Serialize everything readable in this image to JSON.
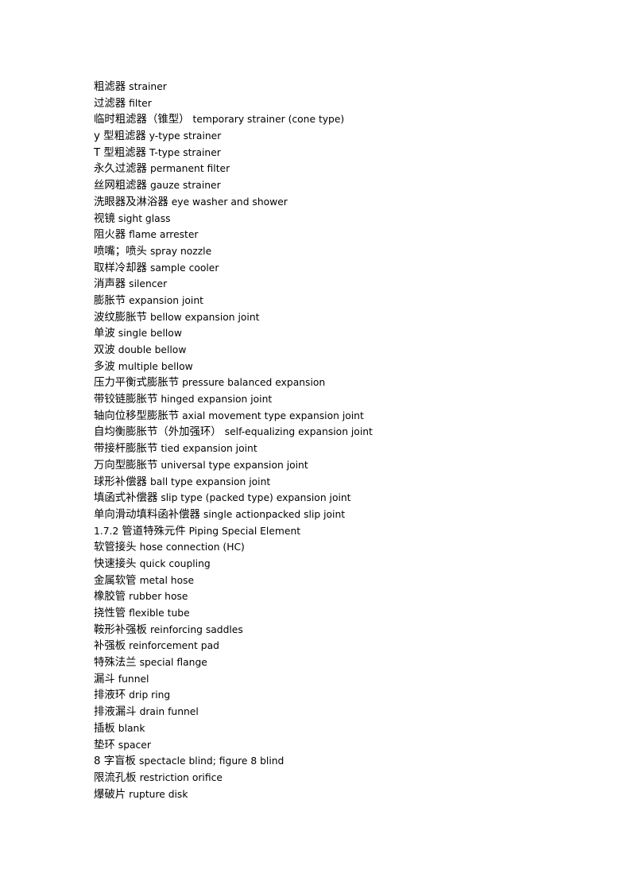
{
  "page": {
    "background_color": "#ffffff",
    "text_color": "#000000"
  },
  "glossary": {
    "entries": [
      {
        "term": "粗滤器",
        "gloss": "strainer"
      },
      {
        "term": "过滤器",
        "gloss": "filter"
      },
      {
        "term": "临时粗滤器（锥型）",
        "gloss": "temporary strainer (cone type)"
      },
      {
        "term": "y 型粗滤器",
        "gloss": "y-type strainer"
      },
      {
        "term": "T 型粗滤器",
        "gloss": "T-type strainer"
      },
      {
        "term": "永久过滤器",
        "gloss": "permanent filter"
      },
      {
        "term": "丝网粗滤器",
        "gloss": "gauze strainer"
      },
      {
        "term": "洗眼器及淋浴器",
        "gloss": "eye washer and shower"
      },
      {
        "term": "视镜",
        "gloss": "sight glass"
      },
      {
        "term": "阻火器",
        "gloss": "flame arrester"
      },
      {
        "term": "喷嘴；喷头",
        "gloss": "spray nozzle"
      },
      {
        "term": "取样冷却器",
        "gloss": "sample cooler"
      },
      {
        "term": "消声器",
        "gloss": "silencer"
      },
      {
        "term": "膨胀节",
        "gloss": "expansion joint"
      },
      {
        "term": "波纹膨胀节",
        "gloss": "bellow expansion joint"
      },
      {
        "term": "单波",
        "gloss": "single bellow"
      },
      {
        "term": "双波",
        "gloss": "double bellow"
      },
      {
        "term": "多波",
        "gloss": "multiple bellow"
      },
      {
        "term": "压力平衡式膨胀节",
        "gloss": "pressure balanced expansion"
      },
      {
        "term": "带铰链膨胀节",
        "gloss": "hinged expansion joint"
      },
      {
        "term": "轴向位移型膨胀节",
        "gloss": "axial movement type expansion joint"
      },
      {
        "term": "自均衡膨胀节（外加强环）",
        "gloss": "self-equalizing expansion joint"
      },
      {
        "term": "带接杆膨胀节",
        "gloss": "tied expansion joint"
      },
      {
        "term": "万向型膨胀节",
        "gloss": "universal type expansion joint"
      },
      {
        "term": "球形补偿器",
        "gloss": "ball type expansion joint"
      },
      {
        "term": "填函式补偿器",
        "gloss": "slip type (packed type) expansion joint"
      },
      {
        "term": "单向滑动填料函补偿器",
        "gloss": "single actionpacked slip joint"
      },
      {
        "heading": true,
        "number": "1.7.2",
        "term": "管道特殊元件",
        "gloss": "Piping Special Element"
      },
      {
        "term": "软管接头",
        "gloss": "hose connection (HC)"
      },
      {
        "term": "快速接头",
        "gloss": "quick coupling"
      },
      {
        "term": "金属软管",
        "gloss": "metal hose"
      },
      {
        "term": "橡胶管",
        "gloss": "rubber hose"
      },
      {
        "term": "挠性管",
        "gloss": "flexible tube"
      },
      {
        "term": "鞍形补强板",
        "gloss": "reinforcing saddles"
      },
      {
        "term": "补强板",
        "gloss": "reinforcement pad"
      },
      {
        "term": "特殊法兰",
        "gloss": "special flange"
      },
      {
        "term": "漏斗",
        "gloss": "funnel"
      },
      {
        "term": "排液环",
        "gloss": "drip ring"
      },
      {
        "term": "排液漏斗",
        "gloss": "drain funnel"
      },
      {
        "term": "插板",
        "gloss": "blank"
      },
      {
        "term": "垫环",
        "gloss": "spacer"
      },
      {
        "term": "8 字盲板",
        "gloss": "spectacle blind; figure 8 blind"
      },
      {
        "term": "限流孔板",
        "gloss": "restriction orifice"
      },
      {
        "term": "爆破片",
        "gloss": "rupture disk"
      }
    ]
  }
}
